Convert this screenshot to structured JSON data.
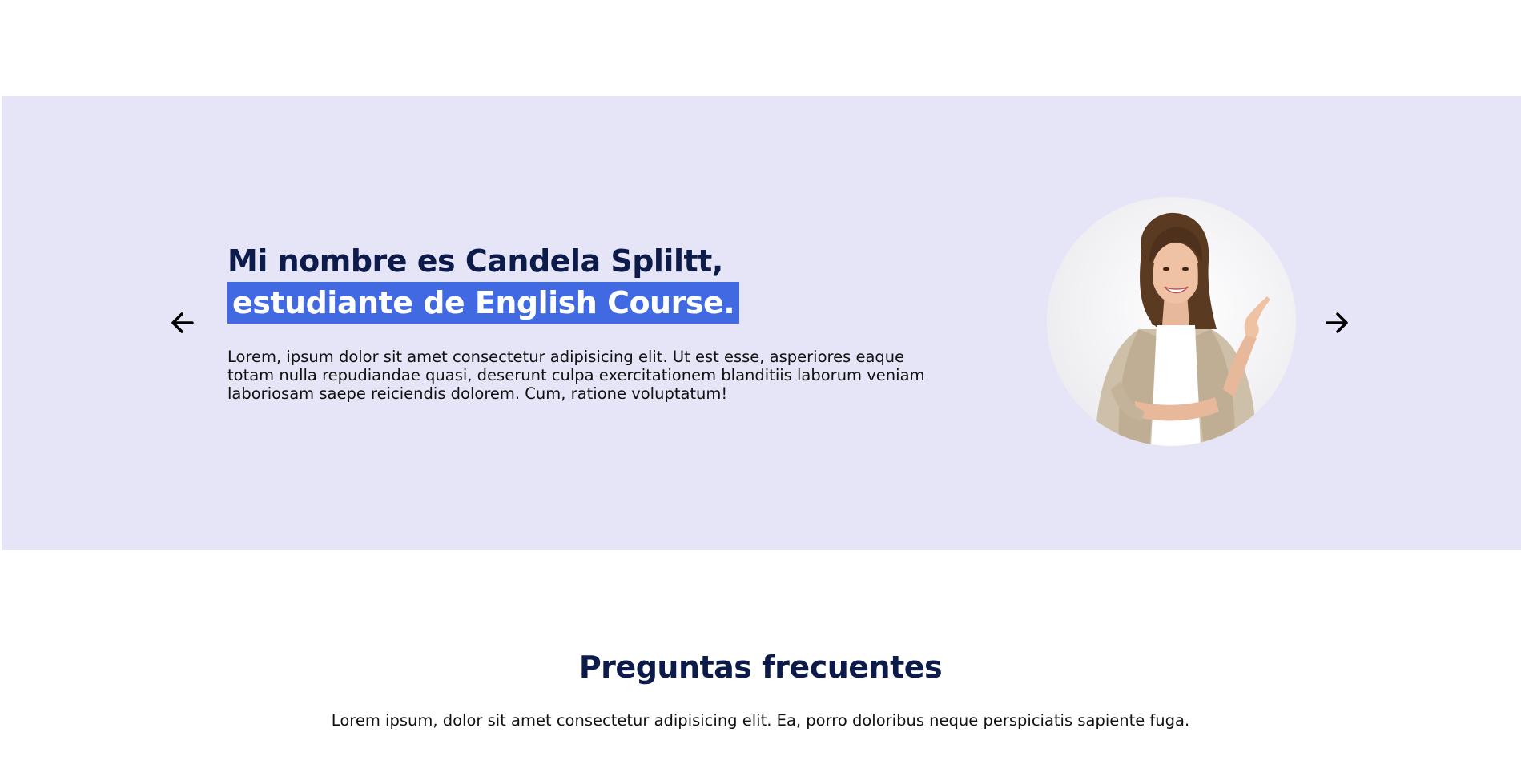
{
  "testimonial": {
    "headline_line1": "Mi nombre es Candela Spliltt,",
    "headline_line2": "estudiante de English Course.",
    "bio": "Lorem, ipsum dolor sit amet consectetur adipisicing elit. Ut est esse, asperiores eaque totam nulla repudiandae quasi, deserunt culpa exercitationem blanditiis laborum veniam laboriosam saepe reiciendis dolorem. Cum, ratione voluptatum!",
    "prev_icon": "arrow-left-icon",
    "next_icon": "arrow-right-icon",
    "background_color": "#e5e5f7",
    "highlight_color": "#4169e1",
    "heading_color": "#0c1b4a"
  },
  "faq": {
    "title": "Preguntas frecuentes",
    "subtitle": "Lorem ipsum, dolor sit amet consectetur adipisicing elit. Ea, porro doloribus neque perspiciatis sapiente fuga."
  }
}
